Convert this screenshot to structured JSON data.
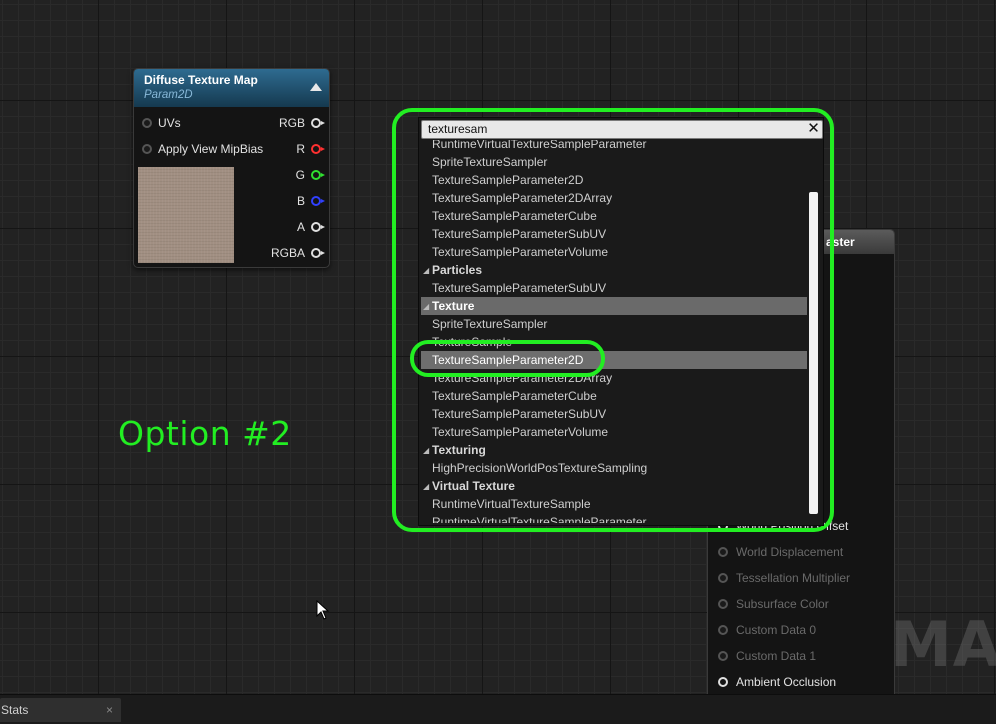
{
  "texture_node": {
    "title": "Diffuse Texture Map",
    "subtitle": "Param2D",
    "inputs": [
      "UVs",
      "Apply View MipBias"
    ],
    "outputs": [
      "RGB",
      "R",
      "G",
      "B",
      "A",
      "RGBA"
    ]
  },
  "master_node": {
    "title": "aster",
    "pins": [
      {
        "label": "World Position Offset",
        "enabled": true
      },
      {
        "label": "World Displacement",
        "enabled": false
      },
      {
        "label": "Tessellation Multiplier",
        "enabled": false
      },
      {
        "label": "Subsurface Color",
        "enabled": false
      },
      {
        "label": "Custom Data 0",
        "enabled": false
      },
      {
        "label": "Custom Data 1",
        "enabled": false
      },
      {
        "label": "Ambient Occlusion",
        "enabled": true
      }
    ],
    "watermark": "MAT"
  },
  "annotation": {
    "option_label": "Option #2"
  },
  "palette": {
    "search_value": "texturesam",
    "items": [
      {
        "type": "item",
        "label": "RuntimeVirtualTextureSampleParameter"
      },
      {
        "type": "item",
        "label": "SpriteTextureSampler"
      },
      {
        "type": "item",
        "label": "TextureSampleParameter2D"
      },
      {
        "type": "item",
        "label": "TextureSampleParameter2DArray"
      },
      {
        "type": "item",
        "label": "TextureSampleParameterCube"
      },
      {
        "type": "item",
        "label": "TextureSampleParameterSubUV"
      },
      {
        "type": "item",
        "label": "TextureSampleParameterVolume"
      },
      {
        "type": "category",
        "label": "Particles"
      },
      {
        "type": "item",
        "label": "TextureSampleParameterSubUV"
      },
      {
        "type": "category",
        "label": "Texture",
        "selected": true
      },
      {
        "type": "item",
        "label": "SpriteTextureSampler"
      },
      {
        "type": "item",
        "label": "TextureSample"
      },
      {
        "type": "item",
        "label": "TextureSampleParameter2D",
        "selected": true
      },
      {
        "type": "item",
        "label": "TextureSampleParameter2DArray"
      },
      {
        "type": "item",
        "label": "TextureSampleParameterCube"
      },
      {
        "type": "item",
        "label": "TextureSampleParameterSubUV"
      },
      {
        "type": "item",
        "label": "TextureSampleParameterVolume"
      },
      {
        "type": "category",
        "label": "Texturing"
      },
      {
        "type": "item",
        "label": "HighPrecisionWorldPosTextureSampling"
      },
      {
        "type": "category",
        "label": "Virtual Texture"
      },
      {
        "type": "item",
        "label": "RuntimeVirtualTextureSample"
      },
      {
        "type": "item",
        "label": "RuntimeVirtualTextureSampleParameter"
      }
    ]
  },
  "bottom_tabs": [
    {
      "label": "Stats",
      "close": "×"
    }
  ],
  "colors": {
    "highlight": "#22ee22",
    "pin_r": "#ff3030",
    "pin_g": "#30e030",
    "pin_b": "#3040ff"
  }
}
